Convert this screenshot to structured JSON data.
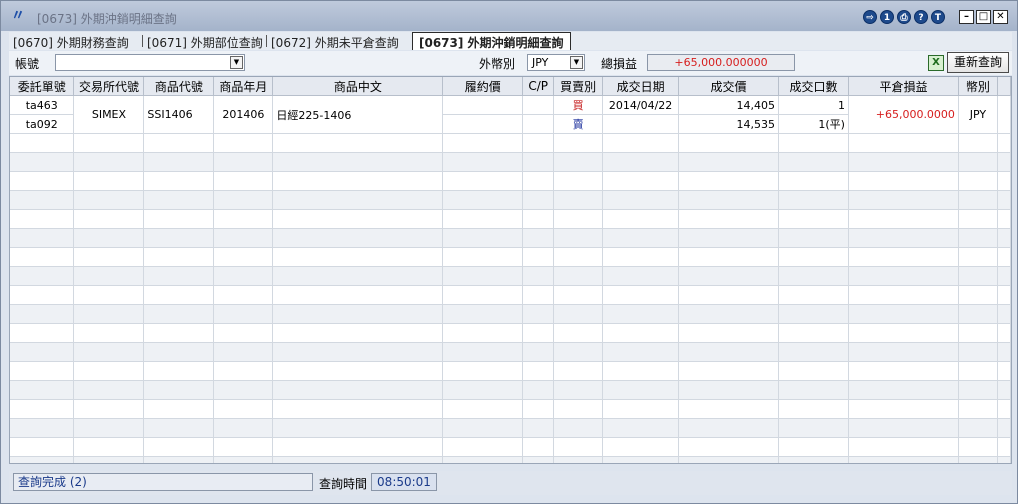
{
  "window": {
    "title": "[0673] 外期沖銷明細查詢",
    "controls": [
      "⇨",
      "1",
      "⎙",
      "?",
      "T"
    ]
  },
  "tabs": [
    {
      "label": "[0670] 外期財務查詢",
      "active": false
    },
    {
      "label": "[0671] 外期部位查詢",
      "active": false
    },
    {
      "label": "[0672] 外期未平倉查詢",
      "active": false
    },
    {
      "label": "[0673] 外期沖銷明細查詢",
      "active": true
    }
  ],
  "toolbar": {
    "account_label": "帳號",
    "account_value": "",
    "currency_label": "外幣別",
    "currency_value": "JPY",
    "total_pnl_label": "總損益",
    "total_pnl_value": "+65,000.000000",
    "requery_label": "重新查詢",
    "excel_icon": "excel-icon"
  },
  "table": {
    "columns": [
      "委託單號",
      "交易所代號",
      "商品代號",
      "商品年月",
      "商品中文",
      "履約價",
      "C/P",
      "買賣別",
      "成交日期",
      "成交價",
      "成交口數",
      "平倉損益",
      "幣別"
    ],
    "group": {
      "exchange": "SIMEX",
      "product_code": "SSI1406",
      "product_month": "201406",
      "product_name": "日經225-1406",
      "strike": "",
      "cp": "",
      "pnl": "+65,000.0000",
      "currency": "JPY"
    },
    "rows": [
      {
        "order_no": "ta463",
        "side": "買",
        "trade_date": "2014/04/22",
        "price": "14,405",
        "qty": "1"
      },
      {
        "order_no": "ta092",
        "side": "賣",
        "trade_date": "",
        "price": "14,535",
        "qty": "1(平)"
      }
    ]
  },
  "status": {
    "message": "查詢完成 (2)",
    "query_time_label": "查詢時間",
    "query_time": "08:50:01"
  },
  "colors": {
    "buy": "#c41a1a",
    "sell": "#1b2f9c",
    "profit": "#d61e1e",
    "accent": "#1e4a8c"
  }
}
